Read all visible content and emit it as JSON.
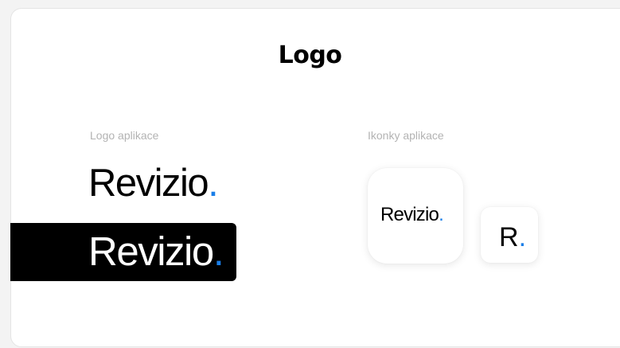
{
  "page": {
    "title": "Logo"
  },
  "sections": {
    "logo_label": "Logo aplikace",
    "icons_label": "Ikonky aplikace"
  },
  "logo": {
    "wordmark": "Revizio",
    "dot": "."
  },
  "icons": {
    "large_text": "Revizio",
    "small_text": "R",
    "dot": "."
  },
  "colors": {
    "accent": "#1a7ee8",
    "text": "#000000",
    "dark_background": "#000000",
    "label": "#b3b3b3"
  }
}
